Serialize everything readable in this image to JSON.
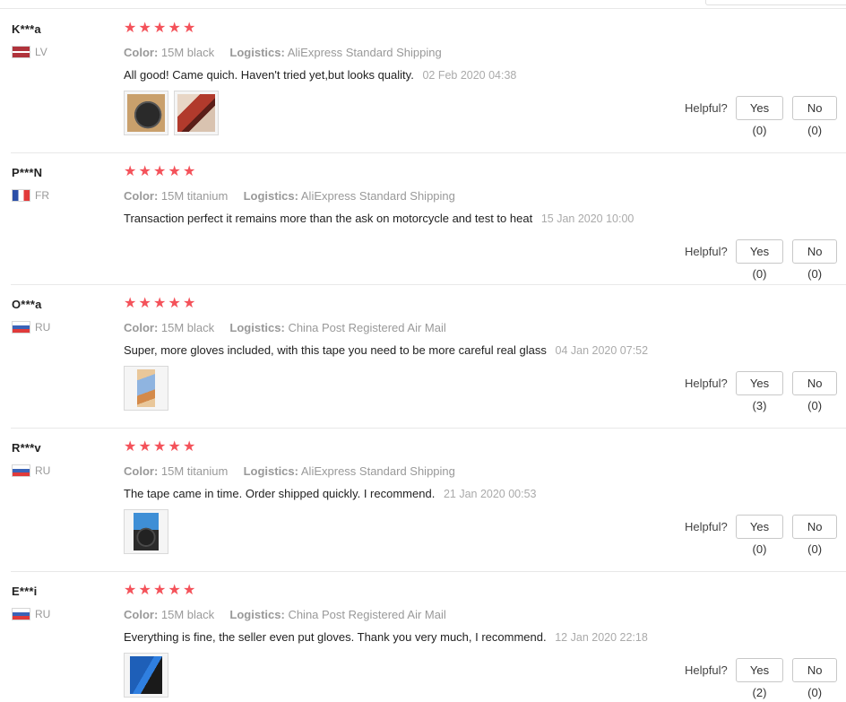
{
  "helpful_label": "Helpful?",
  "star_glyph": "★",
  "colors": {
    "star": "#f4525a",
    "muted": "#999999"
  },
  "reviews": [
    {
      "user": "K***a",
      "country": "LV",
      "rating": 5,
      "color_label": "Color:",
      "color_value": "15M black",
      "logistics_label": "Logistics:",
      "logistics_value": "AliExpress Standard Shipping",
      "text": "All good! Came quich. Haven't tried yet,but looks quality.",
      "date": "02 Feb 2020 04:38",
      "photos": [
        "black-tape-roll-photo",
        "red-tape-hand-photo"
      ],
      "yes_label": "Yes (0)",
      "no_label": "No (0)"
    },
    {
      "user": "P***N",
      "country": "FR",
      "rating": 5,
      "color_label": "Color:",
      "color_value": "15M titanium",
      "logistics_label": "Logistics:",
      "logistics_value": "AliExpress Standard Shipping",
      "text": "Transaction perfect it remains more than the ask on motorcycle and test to heat",
      "date": "15 Jan 2020 10:00",
      "photos": [],
      "yes_label": "Yes (0)",
      "no_label": "No (0)"
    },
    {
      "user": "O***a",
      "country": "RU",
      "rating": 5,
      "color_label": "Color:",
      "color_value": "15M black",
      "logistics_label": "Logistics:",
      "logistics_value": "China Post Registered Air Mail",
      "text": "Super, more gloves included, with this tape you need to be more careful real glass",
      "date": "04 Jan 2020 07:52",
      "photos": [
        "gloves-package-photo"
      ],
      "yes_label": "Yes (3)",
      "no_label": "No (0)"
    },
    {
      "user": "R***v",
      "country": "RU",
      "rating": 5,
      "color_label": "Color:",
      "color_value": "15M titanium",
      "logistics_label": "Logistics:",
      "logistics_value": "AliExpress Standard Shipping",
      "text": "The tape came in time. Order shipped quickly. I recommend.",
      "date": "21 Jan 2020 00:53",
      "photos": [
        "tape-with-gloves-photo"
      ],
      "yes_label": "Yes (0)",
      "no_label": "No (0)"
    },
    {
      "user": "E***i",
      "country": "RU",
      "rating": 5,
      "color_label": "Color:",
      "color_value": "15M black",
      "logistics_label": "Logistics:",
      "logistics_value": "China Post Registered Air Mail",
      "text": "Everything is fine, the seller even put gloves. Thank you very much, I recommend.",
      "date": "12 Jan 2020 22:18",
      "photos": [
        "blue-gloves-tape-photo"
      ],
      "yes_label": "Yes (2)",
      "no_label": "No (0)"
    }
  ]
}
